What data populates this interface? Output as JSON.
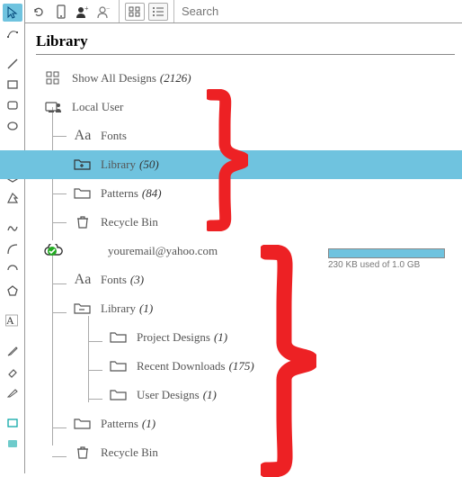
{
  "toolbar": {
    "search_placeholder": "Search"
  },
  "panel_title": "Library",
  "tree": {
    "show_all": {
      "label": "Show All Designs",
      "count": "(2126)"
    },
    "local_user": {
      "label": "Local User",
      "fonts": {
        "label": "Fonts"
      },
      "library": {
        "label": "Library",
        "count": "(50)"
      },
      "patterns": {
        "label": "Patterns",
        "count": "(84)"
      },
      "recycle": {
        "label": "Recycle Bin"
      }
    },
    "cloud_user": {
      "label": "youremail@yahoo.com",
      "fonts": {
        "label": "Fonts",
        "count": "(3)"
      },
      "library": {
        "label": "Library",
        "count": "(1)",
        "project_designs": {
          "label": "Project Designs",
          "count": "(1)"
        },
        "recent_downloads": {
          "label": "Recent Downloads",
          "count": "(175)"
        },
        "user_designs": {
          "label": "User Designs",
          "count": "(1)"
        }
      },
      "patterns": {
        "label": "Patterns",
        "count": "(1)"
      },
      "recycle": {
        "label": "Recycle Bin"
      }
    }
  },
  "storage": {
    "text": "230 KB used of 1.0 GB"
  }
}
